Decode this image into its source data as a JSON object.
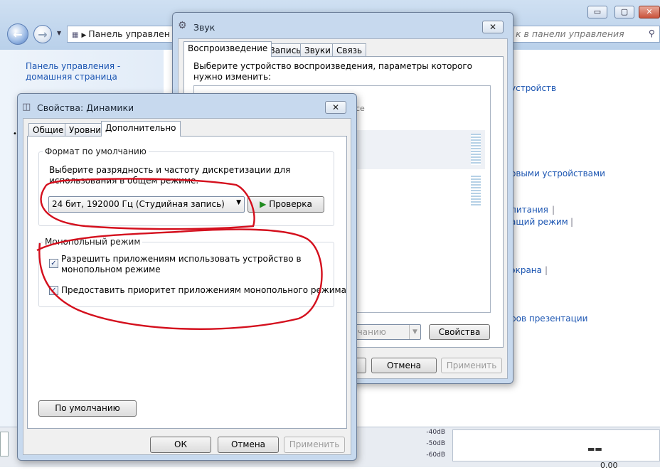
{
  "explorer": {
    "address": "Панель управлен",
    "search_placeholder": "к в панели управления",
    "sidebar_link": "Панель управления - домашняя страница",
    "links": [
      "устройств",
      "овыми устройствами",
      "питания",
      "ащий режим",
      "экрана",
      "ров презентации"
    ],
    "window_controls": {
      "minimize": "▭",
      "maximize": "▢",
      "close": "✕"
    }
  },
  "sound_dialog": {
    "title": "Звук",
    "tabs": [
      "Воспроизведение",
      "Запись",
      "Звуки",
      "Связь"
    ],
    "instruction": "Выберите устройство воспроизведения, параметры которого нужно изменить:",
    "device_fragment": "се",
    "default_button": "лчанию",
    "properties_button": "Свойства",
    "cancel_button": "Отмена",
    "apply_button": "Применить"
  },
  "props_dialog": {
    "title": "Свойства: Динамики",
    "tabs": [
      "Общие",
      "Уровни",
      "Дополнительно"
    ],
    "format_group": {
      "legend": "Формат по умолчанию",
      "description": "Выберите разрядность и частоту дискретизации для использования в общем режиме.",
      "selected_format": "24 бит, 192000 Гц (Студийная запись)",
      "test_button": "Проверка"
    },
    "exclusive_group": {
      "legend": "Монопольный режим",
      "option1": "Разрешить приложениям использовать устройство в монопольном режиме",
      "option1_checked": true,
      "option2": "Предоставить приоритет приложениям монопольного режима",
      "option2_checked": true
    },
    "defaults_button": "По умолчанию",
    "ok_button": "ОК",
    "cancel_button": "Отмена",
    "apply_button": "Применить"
  },
  "bottom": {
    "db_labels": [
      "-40dB",
      "-50dB",
      "-60dB"
    ],
    "status_fragment": "0.00"
  }
}
